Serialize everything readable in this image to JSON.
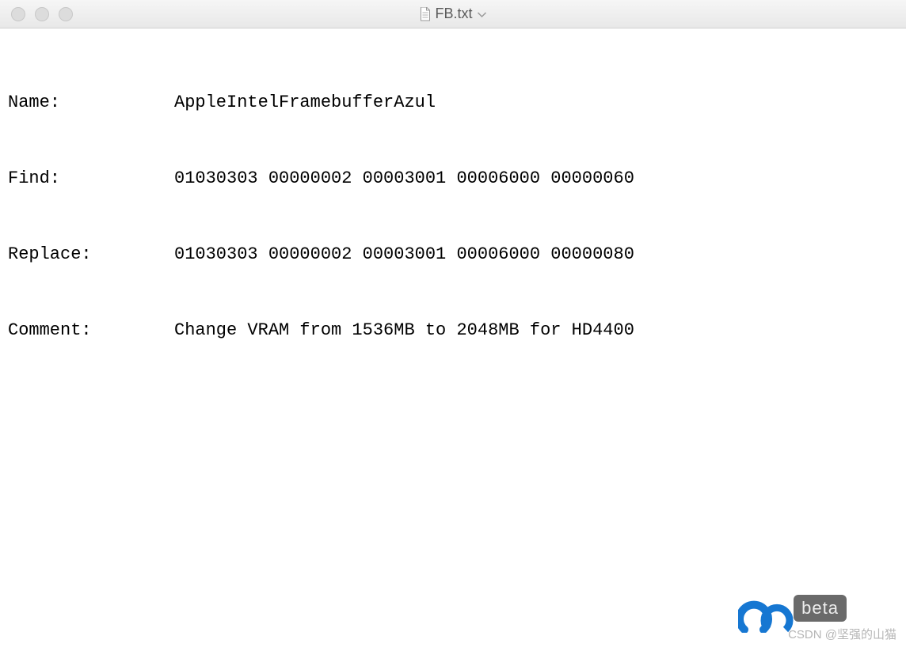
{
  "titlebar": {
    "filename": "FB.txt"
  },
  "rows": {
    "r0": {
      "label": "Name:",
      "value": "AppleIntelFramebufferAzul"
    },
    "r1": {
      "label": "Find:",
      "value": "01030303 00000002 00003001 00006000 00000060"
    },
    "r2": {
      "label": "Replace:",
      "value": "01030303 00000002 00003001 00006000 00000080"
    },
    "r3": {
      "label": "Comment:",
      "value": "Change VRAM from 1536MB to 2048MB for HD4400"
    }
  },
  "watermark": {
    "beta": "beta",
    "csdn": "CSDN @坚强的山猫"
  }
}
